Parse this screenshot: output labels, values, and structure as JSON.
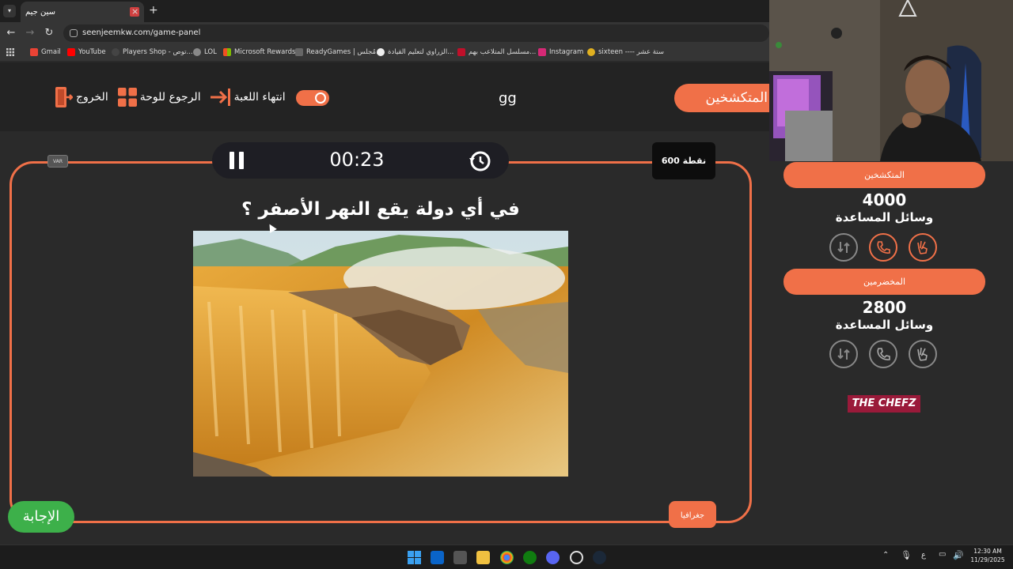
{
  "browser": {
    "tab_title": "سين جيم",
    "tab_close": "×",
    "new_tab": "+",
    "url": "seenjeemkw.com/game-panel",
    "bookmarks": [
      {
        "label": "Gmail",
        "icon": "gmail-icon",
        "color": "#ea4335"
      },
      {
        "label": "YouTube",
        "icon": "youtube-icon",
        "color": "#ff0000"
      },
      {
        "label": "Players Shop - توص...",
        "icon": "players-shop-icon",
        "color": "#444444"
      },
      {
        "label": "LOL",
        "icon": "globe-icon",
        "color": "#888888"
      },
      {
        "label": "Microsoft Rewards",
        "icon": "microsoft-icon",
        "color": "#f25022"
      },
      {
        "label": "ReadyGames | مُجلس...",
        "icon": "readygames-icon",
        "color": "#666666"
      },
      {
        "label": "الزراوي لتعليم القيادة...",
        "icon": "zarawi-icon",
        "color": "#eeeeee"
      },
      {
        "label": "مسلسل المتلاعب بهم...",
        "icon": "series-icon",
        "color": "#c0102a"
      },
      {
        "label": "Instagram",
        "icon": "instagram-icon",
        "color": "#d62976"
      },
      {
        "label": "sixteen ---- ستة عشر",
        "icon": "sixteen-icon",
        "color": "#e0b020"
      }
    ]
  },
  "header": {
    "exit_label": "الخروج",
    "back_to_board_label": "الرجوع للوحة",
    "end_game_label": "انتهاء اللعبة",
    "team_name": "gg",
    "current_team": "المتكشخين"
  },
  "board": {
    "timer": "00:23",
    "var_label": "VAR",
    "points": "600 نقطة",
    "question": "في أي دولة يقع النهر الأصفر ؟",
    "category": "جغرافيا",
    "answer_button": "الإجابة"
  },
  "teams": [
    {
      "name": "المتكشخين",
      "score": "4000",
      "lifelines_label": "وسائل المساعدة"
    },
    {
      "name": "المخضرمين",
      "score": "2800",
      "lifelines_label": "وسائل المساعدة"
    }
  ],
  "sponsor": {
    "logo_text_a": "THE CHEF",
    "logo_text_b": "Z"
  },
  "taskbar": {
    "time": "12:30 AM",
    "date": "11/29/2025",
    "lang": "ع"
  },
  "colors": {
    "accent": "#f07048",
    "answer_green": "#3db04a",
    "background": "#2a2a2a"
  }
}
